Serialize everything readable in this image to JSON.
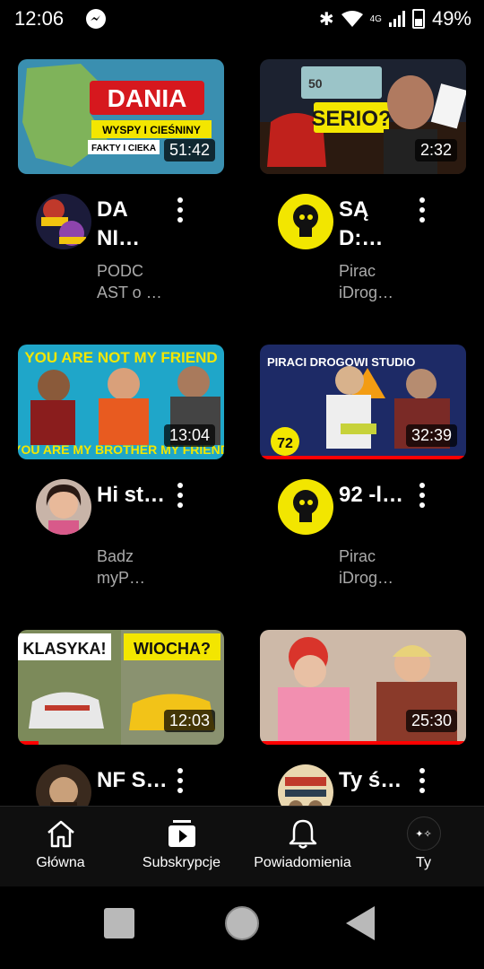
{
  "status": {
    "time": "12:06",
    "network": "4G",
    "battery": "49%"
  },
  "videos": [
    {
      "title": "DA NI…",
      "channel": "PODC AST o …",
      "duration": "51:42",
      "thumb_text": "DANIA",
      "thumb_sub": "WYSPY I CIEŚNINY",
      "thumb_sub2": "FAKTY I CIEKA"
    },
    {
      "title": "SĄ D:…",
      "channel": "Pirac iDrog…",
      "duration": "2:32",
      "thumb_text": "SERIO?",
      "thumb_sub": "50",
      "thumb_sub2": ""
    },
    {
      "title": "Hi st…",
      "channel": "Badz myP…",
      "duration": "13:04",
      "thumb_text": "YOU ARE NOT MY FRIEND",
      "thumb_sub": "YOU ARE MY BROTHER MY FRIEND",
      "thumb_sub2": ""
    },
    {
      "title": "92 -l…",
      "channel": "Pirac iDrog…",
      "duration": "32:39",
      "thumb_text": "PIRACI DROGOWI STUDIO",
      "thumb_sub": "72",
      "thumb_sub2": ""
    },
    {
      "title": "NF S…",
      "channel": "",
      "duration": "12:03",
      "thumb_text": "KLASYKA!",
      "thumb_sub": "WIOCHA?",
      "thumb_sub2": ""
    },
    {
      "title": "Ty ś…",
      "channel": "",
      "duration": "25:30",
      "thumb_text": "",
      "thumb_sub": "",
      "thumb_sub2": ""
    }
  ],
  "nav": [
    {
      "label": "Główna",
      "icon": "home-icon"
    },
    {
      "label": "Subskrypcje",
      "icon": "subscriptions-icon"
    },
    {
      "label": "Powiadomienia",
      "icon": "bell-icon"
    },
    {
      "label": "Ty",
      "icon": "profile-avatar"
    }
  ],
  "colors": {
    "accent": "#ff0000",
    "background": "#000000",
    "secondary_text": "#aaaaaa"
  }
}
